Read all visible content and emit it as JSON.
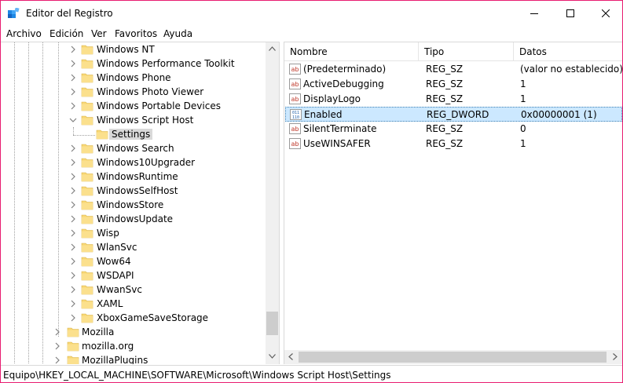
{
  "window": {
    "title": "Editor del Registro",
    "accent": "#e81c71"
  },
  "menu": [
    "Archivo",
    "Edición",
    "Ver",
    "Favoritos",
    "Ayuda"
  ],
  "tree": {
    "items": [
      {
        "label": "Windows NT",
        "expanded": false
      },
      {
        "label": "Windows Performance Toolkit",
        "expanded": false
      },
      {
        "label": "Windows Phone",
        "expanded": false
      },
      {
        "label": "Windows Photo Viewer",
        "expanded": false
      },
      {
        "label": "Windows Portable Devices",
        "expanded": false
      },
      {
        "label": "Windows Script Host",
        "expanded": true
      },
      {
        "label": "Settings",
        "selected": true
      },
      {
        "label": "Windows Search",
        "expanded": false
      },
      {
        "label": "Windows10Upgrader",
        "expanded": false
      },
      {
        "label": "WindowsRuntime",
        "expanded": false
      },
      {
        "label": "WindowsSelfHost",
        "expanded": false
      },
      {
        "label": "WindowsStore",
        "expanded": false
      },
      {
        "label": "WindowsUpdate",
        "expanded": false
      },
      {
        "label": "Wisp",
        "expanded": false
      },
      {
        "label": "WlanSvc",
        "expanded": false
      },
      {
        "label": "Wow64",
        "expanded": false
      },
      {
        "label": "WSDAPI",
        "expanded": false
      },
      {
        "label": "WwanSvc",
        "expanded": false
      },
      {
        "label": "XAML",
        "expanded": false
      },
      {
        "label": "XboxGameSaveStorage",
        "expanded": false
      },
      {
        "label": "Mozilla",
        "expanded": false
      },
      {
        "label": "mozilla.org",
        "expanded": false
      },
      {
        "label": "MozillaPlugins",
        "expanded": false
      }
    ]
  },
  "list": {
    "columns": [
      "Nombre",
      "Tipo",
      "Datos"
    ],
    "rows": [
      {
        "icon": "string-value-icon",
        "name": "(Predeterminado)",
        "type": "REG_SZ",
        "data": "(valor no establecido)"
      },
      {
        "icon": "string-value-icon",
        "name": "ActiveDebugging",
        "type": "REG_SZ",
        "data": "1"
      },
      {
        "icon": "string-value-icon",
        "name": "DisplayLogo",
        "type": "REG_SZ",
        "data": "1"
      },
      {
        "icon": "binary-value-icon",
        "name": "Enabled",
        "type": "REG_DWORD",
        "data": "0x00000001 (1)",
        "selected": true
      },
      {
        "icon": "string-value-icon",
        "name": "SilentTerminate",
        "type": "REG_SZ",
        "data": "0"
      },
      {
        "icon": "string-value-icon",
        "name": "UseWINSAFER",
        "type": "REG_SZ",
        "data": "1"
      }
    ]
  },
  "status": {
    "path": "Equipo\\HKEY_LOCAL_MACHINE\\SOFTWARE\\Microsoft\\Windows Script Host\\Settings"
  },
  "colors": {
    "selected_row": "#cce8ff",
    "selected_tree": "#d9d9d9",
    "folder": "#f8d775"
  }
}
